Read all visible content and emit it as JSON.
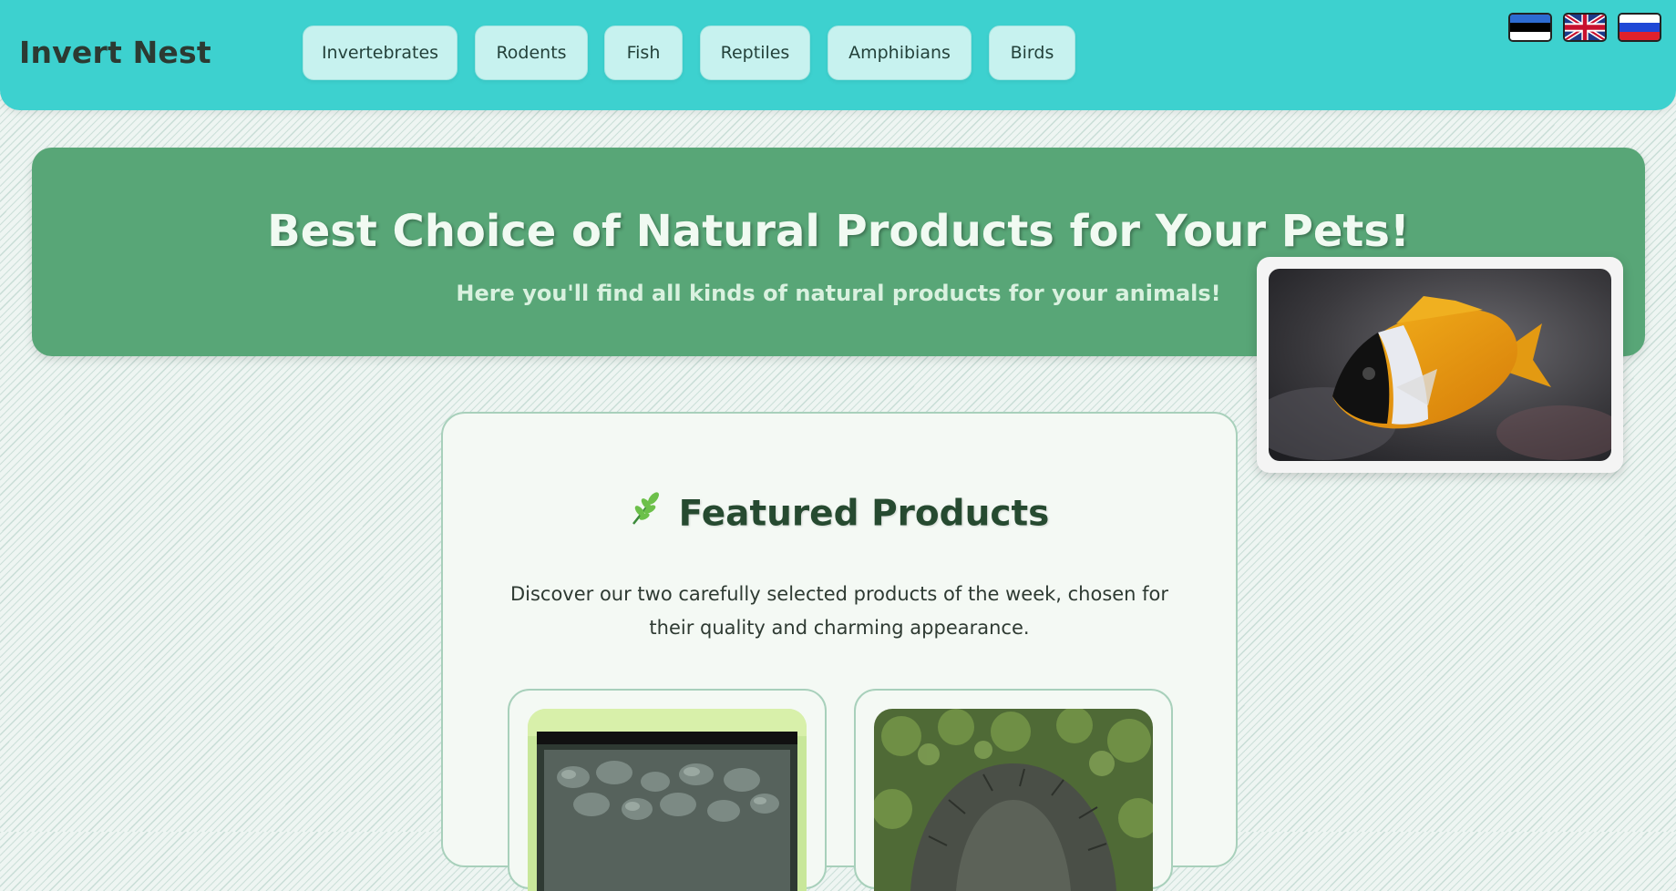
{
  "header": {
    "logo": "Invert Nest",
    "nav": [
      "Invertebrates",
      "Rodents",
      "Fish",
      "Reptiles",
      "Amphibians",
      "Birds"
    ],
    "languages": [
      "estonian-flag-icon",
      "uk-flag-icon",
      "russian-flag-icon"
    ]
  },
  "hero": {
    "title": "Best Choice of Natural Products for Your Pets!",
    "subtitle": "Here you'll find all kinds of natural products for your animals!",
    "image_alt": "foxface fish photo"
  },
  "featured": {
    "title": "Featured Products",
    "description": "Discover our two carefully selected products of the week, chosen for their quality and charming appearance.",
    "products": [
      {
        "image": "aquarium tank photo"
      },
      {
        "image": "euphorbia plant photo"
      }
    ]
  },
  "colors": {
    "header": "#3dd1cf",
    "nav_button": "#c7f2ef",
    "hero": "#58a677",
    "card_border": "#a8d0bb"
  }
}
